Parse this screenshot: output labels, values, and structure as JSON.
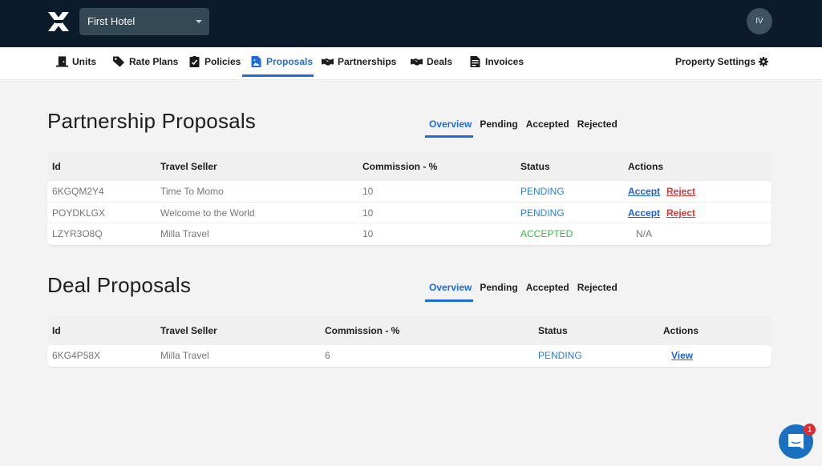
{
  "header": {
    "hotel_select": "First Hotel",
    "avatar_initials": "IV"
  },
  "nav": {
    "items": [
      {
        "label": "Units",
        "icon": "door-icon"
      },
      {
        "label": "Rate Plans",
        "icon": "tag-icon"
      },
      {
        "label": "Policies",
        "icon": "clipboard-check-icon"
      },
      {
        "label": "Proposals",
        "icon": "file-image-icon",
        "active": true
      },
      {
        "label": "Partnerships",
        "icon": "handshake-icon"
      },
      {
        "label": "Deals",
        "icon": "handshake-icon"
      },
      {
        "label": "Invoices",
        "icon": "invoice-icon"
      }
    ],
    "property_settings": "Property Settings"
  },
  "partnership": {
    "title": "Partnership Proposals",
    "tabs": [
      "Overview",
      "Pending",
      "Accepted",
      "Rejected"
    ],
    "active_tab": "Overview",
    "columns": [
      "Id",
      "Travel Seller",
      "Commission - %",
      "Status",
      "Actions"
    ],
    "rows": [
      {
        "id": "6KGQM2Y4",
        "seller": "Time To Momo",
        "commission": "10",
        "status": "PENDING",
        "accept": "Accept",
        "reject": "Reject"
      },
      {
        "id": "POYDKLGX",
        "seller": "Welcome to the World",
        "commission": "10",
        "status": "PENDING",
        "accept": "Accept",
        "reject": "Reject"
      },
      {
        "id": "LZYR3O8Q",
        "seller": "Milla Travel",
        "commission": "10",
        "status": "ACCEPTED",
        "action_text": "N/A"
      }
    ]
  },
  "deal": {
    "title": "Deal Proposals",
    "tabs": [
      "Overview",
      "Pending",
      "Accepted",
      "Rejected"
    ],
    "active_tab": "Overview",
    "columns": [
      "Id",
      "Travel Seller",
      "Commission - %",
      "Status",
      "Actions"
    ],
    "rows": [
      {
        "id": "6KG4P58X",
        "seller": "Milla Travel",
        "commission": "6",
        "status": "PENDING",
        "view": "View"
      }
    ]
  },
  "chat": {
    "badge_count": "1"
  },
  "colors": {
    "accent": "#1e6bdc",
    "topbar": "#0b1b2b",
    "pending": "#2f7de0",
    "accepted": "#35b843",
    "reject": "#d93a3a"
  }
}
